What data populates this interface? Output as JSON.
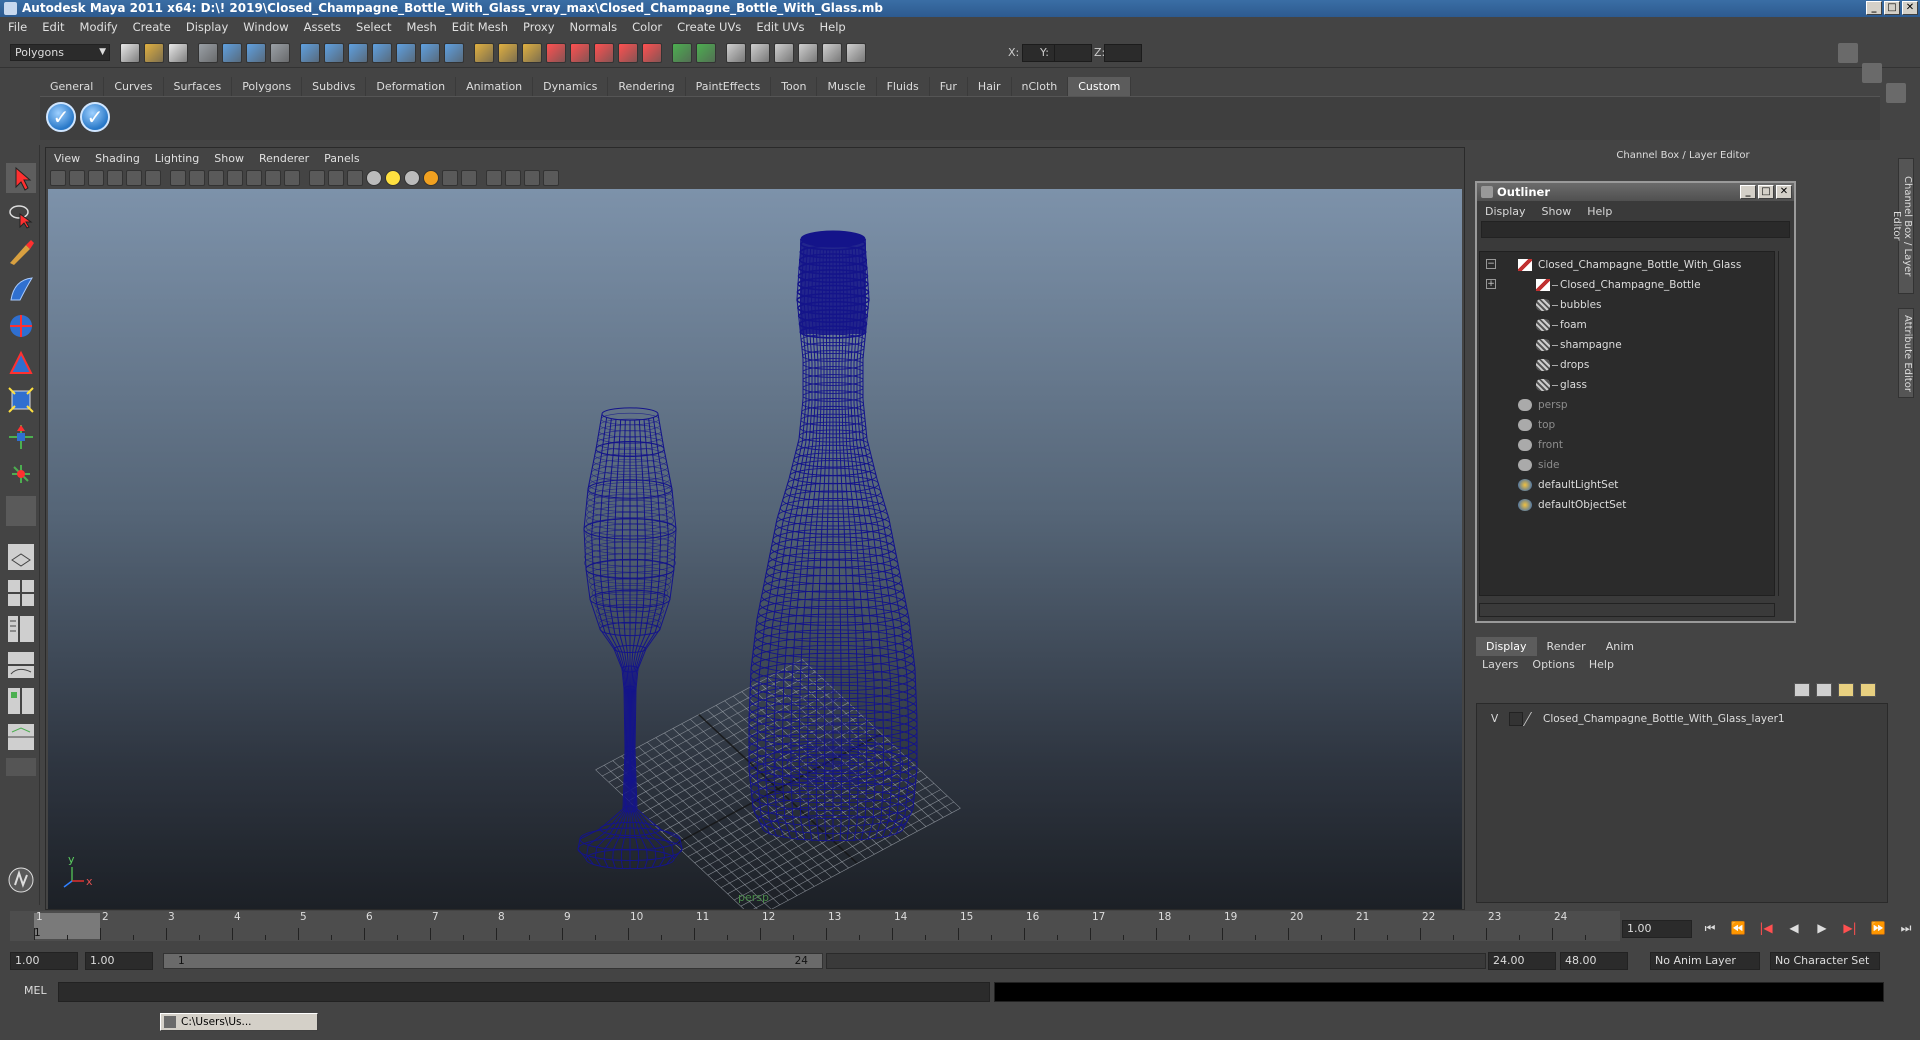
{
  "window": {
    "title": "Autodesk Maya 2011 x64: D:\\! 2019\\Closed_Champagne_Bottle_With_Glass_vray_max\\Closed_Champagne_Bottle_With_Glass.mb",
    "min": "_",
    "max": "□",
    "close": "✕"
  },
  "menubar": [
    "File",
    "Edit",
    "Modify",
    "Create",
    "Display",
    "Window",
    "Assets",
    "Select",
    "Mesh",
    "Edit Mesh",
    "Proxy",
    "Normals",
    "Color",
    "Create UVs",
    "Edit UVs",
    "Help"
  ],
  "status": {
    "mode": "Polygons",
    "x_label": "X:",
    "y_label": "Y:",
    "z_label": "Z:"
  },
  "shelf": {
    "tabs": [
      "General",
      "Curves",
      "Surfaces",
      "Polygons",
      "Subdivs",
      "Deformation",
      "Animation",
      "Dynamics",
      "Rendering",
      "PaintEffects",
      "Toon",
      "Muscle",
      "Fluids",
      "Fur",
      "Hair",
      "nCloth",
      "Custom"
    ],
    "active": "Custom",
    "buttons": [
      "✓",
      "✓"
    ]
  },
  "viewport": {
    "menu": [
      "View",
      "Shading",
      "Lighting",
      "Show",
      "Renderer",
      "Panels"
    ],
    "camera_label": "persp",
    "axis_x": "x",
    "axis_y": "y",
    "wire_color": "#14148a"
  },
  "channel_box": {
    "title": "Channel Box / Layer Editor"
  },
  "outliner": {
    "title": "Outliner",
    "menu": [
      "Display",
      "Show",
      "Help"
    ],
    "items": [
      {
        "label": "Closed_Champagne_Bottle_With_Glass",
        "icon": "group-icon",
        "dim": false
      },
      {
        "label": "Closed_Champagne_Bottle",
        "icon": "group-icon",
        "dim": false
      },
      {
        "label": "bubbles",
        "icon": "mesh-icon",
        "dim": false
      },
      {
        "label": "foam",
        "icon": "mesh-icon",
        "dim": false
      },
      {
        "label": "shampagne",
        "icon": "mesh-icon",
        "dim": false
      },
      {
        "label": "drops",
        "icon": "mesh-icon",
        "dim": false
      },
      {
        "label": "glass",
        "icon": "mesh-icon",
        "dim": false
      },
      {
        "label": "persp",
        "icon": "camera-icon",
        "dim": true
      },
      {
        "label": "top",
        "icon": "camera-icon",
        "dim": true
      },
      {
        "label": "front",
        "icon": "camera-icon",
        "dim": true
      },
      {
        "label": "side",
        "icon": "camera-icon",
        "dim": true
      },
      {
        "label": "defaultLightSet",
        "icon": "set-icon",
        "dim": false
      },
      {
        "label": "defaultObjectSet",
        "icon": "set-icon",
        "dim": false
      }
    ]
  },
  "layers": {
    "tabs": [
      "Display",
      "Render",
      "Anim"
    ],
    "active": "Display",
    "menu": [
      "Layers",
      "Options",
      "Help"
    ],
    "row": {
      "visible": "V",
      "label": "Closed_Champagne_Bottle_With_Glass_layer1"
    }
  },
  "side_tabs": [
    "Channel Box / Layer Editor",
    "Attribute Editor"
  ],
  "timeline": {
    "ticks": [
      "1",
      "2",
      "3",
      "4",
      "5",
      "6",
      "7",
      "8",
      "9",
      "10",
      "11",
      "12",
      "13",
      "14",
      "15",
      "16",
      "17",
      "18",
      "19",
      "20",
      "21",
      "22",
      "23",
      "24"
    ],
    "current_frame": "1.00",
    "current_marker": "1"
  },
  "range": {
    "start": "1.00",
    "playback_start": "1.00",
    "slider_start": "1",
    "slider_end": "24",
    "playback_end": "24.00",
    "end": "48.00",
    "anim_layer": "No Anim Layer",
    "char_set": "No Character Set"
  },
  "command": {
    "label": "MEL"
  },
  "taskbar": {
    "item": "C:\\Users\\Us..."
  }
}
